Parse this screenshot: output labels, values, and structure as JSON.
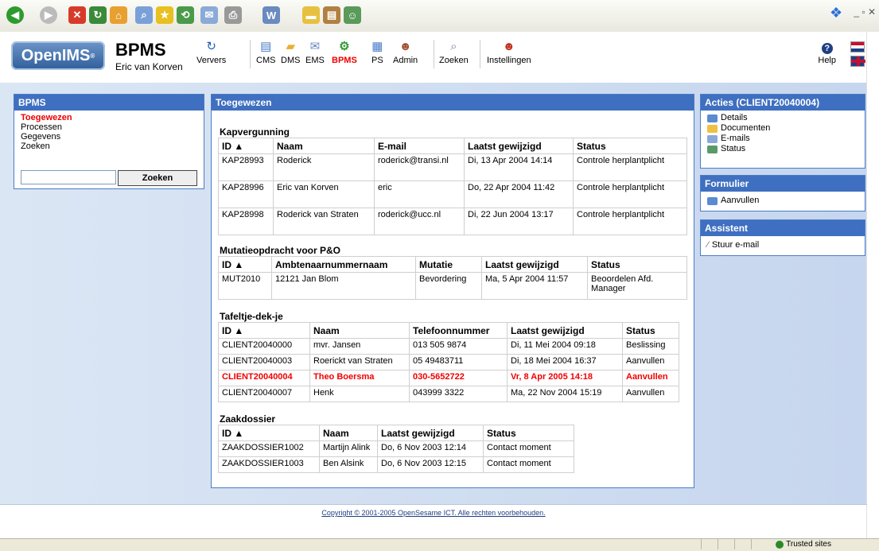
{
  "app": {
    "title": "BPMS",
    "user": "Eric van Korven",
    "logo": "OpenIMS"
  },
  "toolbar": [
    {
      "label": "Ververs",
      "icon": "refresh-icon"
    },
    {
      "label": "CMS",
      "icon": "cms-icon"
    },
    {
      "label": "DMS",
      "icon": "dms-icon"
    },
    {
      "label": "EMS",
      "icon": "ems-icon"
    },
    {
      "label": "BPMS",
      "icon": "bpms-icon",
      "active": true
    },
    {
      "label": "PS",
      "icon": "ps-icon"
    },
    {
      "label": "Admin",
      "icon": "admin-icon"
    },
    {
      "label": "Zoeken",
      "icon": "search-icon"
    },
    {
      "label": "Instellingen",
      "icon": "settings-icon"
    }
  ],
  "help": {
    "label": "Help"
  },
  "sidebar": {
    "title": "BPMS",
    "items": [
      "Toegewezen",
      "Processen",
      "Gegevens",
      "Zoeken"
    ],
    "search_value": "",
    "search_button": "Zoeken"
  },
  "main": {
    "title": "Toegewezen",
    "sections": [
      {
        "title": "Kapvergunning",
        "headers": [
          "ID ▲",
          "Naam",
          "E-mail",
          "Laatst gewijzigd",
          "Status"
        ],
        "rows": [
          [
            "KAP28993",
            "Roderick",
            "roderick@transi.nl",
            "Di, 13 Apr 2004 14:14",
            "Controle herplantplicht"
          ],
          [
            "KAP28996",
            "Eric van Korven",
            "eric",
            "Do, 22 Apr 2004 11:42",
            "Controle herplantplicht"
          ],
          [
            "KAP28998",
            "Roderick van Straten",
            "roderick@ucc.nl",
            "Di, 22 Jun 2004 13:17",
            "Controle herplantplicht"
          ]
        ]
      },
      {
        "title": "Mutatieopdracht voor P&O",
        "headers": [
          "ID ▲",
          "Ambtenaarnummernaam",
          "Mutatie",
          "Laatst gewijzigd",
          "Status"
        ],
        "rows": [
          [
            "MUT2010",
            "12121 Jan Blom",
            "Bevordering",
            "Ma, 5 Apr 2004 11:57",
            "Beoordelen Afd. Manager"
          ]
        ]
      },
      {
        "title": "Tafeltje-dek-je",
        "headers": [
          "ID ▲",
          "Naam",
          "Telefoonnummer",
          "Laatst gewijzigd",
          "Status"
        ],
        "rows": [
          [
            "CLIENT20040000",
            "mvr. Jansen",
            "013 505 9874",
            "Di, 11 Mei 2004 09:18",
            "Beslissing"
          ],
          [
            "CLIENT20040003",
            "Roerickt van Straten",
            "05 49483711",
            "Di, 18 Mei 2004 16:37",
            "Aanvullen"
          ],
          [
            "CLIENT20040004",
            "Theo Boersma",
            "030-5652722",
            "Vr, 8 Apr 2005 14:18",
            "Aanvullen"
          ],
          [
            "CLIENT20040007",
            "Henk",
            "043999 3322",
            "Ma, 22 Nov 2004 15:19",
            "Aanvullen"
          ]
        ],
        "highlight_row": 2
      },
      {
        "title": "Zaakdossier",
        "headers": [
          "ID ▲",
          "Naam",
          "Laatst gewijzigd",
          "Status"
        ],
        "rows": [
          [
            "ZAAKDOSSIER1002",
            "Martijn Alink",
            "Do, 6 Nov 2003 12:14",
            "Contact moment"
          ],
          [
            "ZAAKDOSSIER1003",
            "Ben Alsink",
            "Do, 6 Nov 2003 12:15",
            "Contact moment"
          ]
        ]
      }
    ]
  },
  "actions": {
    "title": "Acties (CLIENT20040004)",
    "items": [
      {
        "label": "Details",
        "icon": "details-icon"
      },
      {
        "label": "Documenten",
        "icon": "folder-icon"
      },
      {
        "label": "E-mails",
        "icon": "email-icon"
      },
      {
        "label": "Status",
        "icon": "status-icon"
      }
    ]
  },
  "formulier": {
    "title": "Formulier",
    "items": [
      {
        "label": "Aanvullen",
        "icon": "form-icon"
      }
    ]
  },
  "assistent": {
    "title": "Assistent",
    "items": [
      {
        "label": "Stuur e-mail",
        "icon": "wand-icon"
      }
    ]
  },
  "footer": {
    "text": "Copyright © 2001-2005 OpenSesame ICT. Alle rechten voorbehouden."
  },
  "statusbar": {
    "zone": "Trusted sites"
  },
  "colors": {
    "accent": "#3f6fc0",
    "highlight": "#e00000",
    "band": "#c6d6ee"
  }
}
